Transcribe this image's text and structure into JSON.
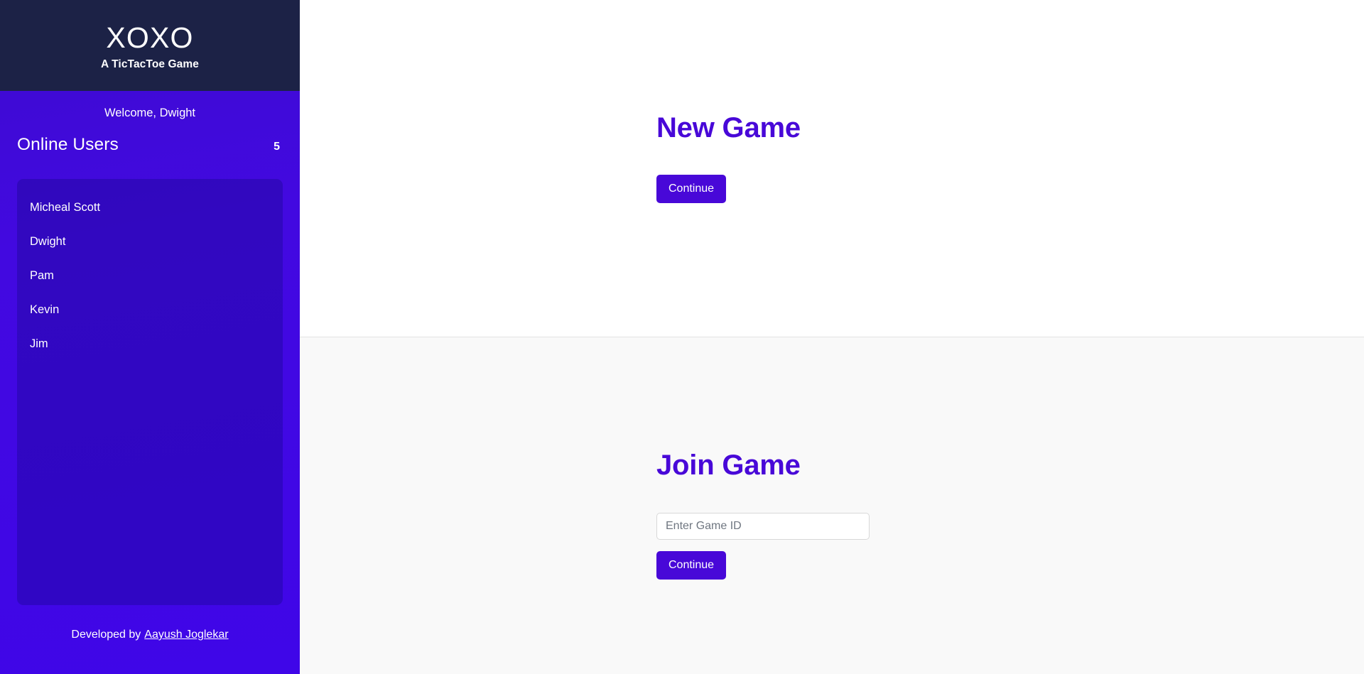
{
  "brand": {
    "title": "XOXO",
    "subtitle": "A TicTacToe Game"
  },
  "sidebar": {
    "welcome": "Welcome, Dwight",
    "online_users_label": "Online Users",
    "online_users_count": "5",
    "users": [
      {
        "name": "Micheal Scott"
      },
      {
        "name": "Dwight"
      },
      {
        "name": "Pam"
      },
      {
        "name": "Kevin"
      },
      {
        "name": "Jim"
      }
    ],
    "footer": {
      "prefix": "Developed by",
      "author": "Aayush Joglekar"
    }
  },
  "main": {
    "new_game": {
      "title": "New Game",
      "continue_label": "Continue"
    },
    "join_game": {
      "title": "Join Game",
      "input_placeholder": "Enter Game ID",
      "input_value": "",
      "continue_label": "Continue"
    }
  },
  "colors": {
    "brand_dark": "#1c2246",
    "accent": "#4808d8",
    "sidebar_purple": "#3f06e8",
    "panel_alt_bg": "#f9f9f9"
  }
}
